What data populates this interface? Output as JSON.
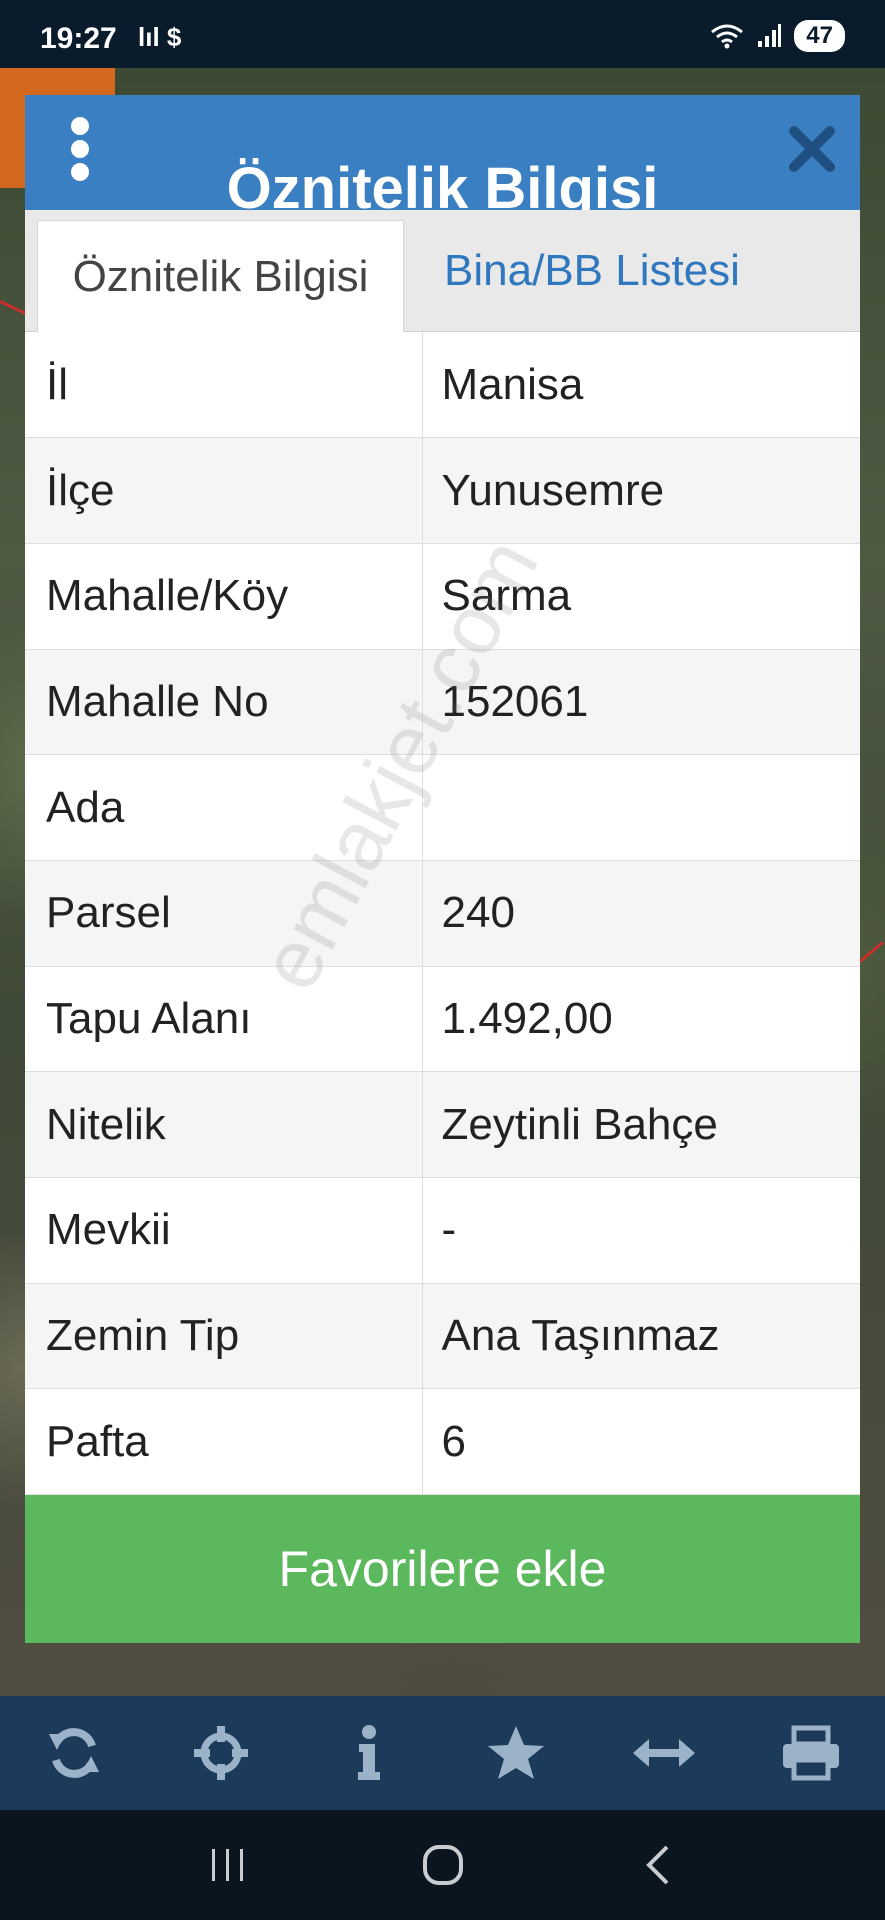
{
  "status_bar": {
    "time": "19:27",
    "left_icons": "lıl $",
    "battery": "47"
  },
  "dialog": {
    "title": "Öznitelik Bilgisi",
    "tabs": [
      {
        "label": "Öznitelik Bilgisi",
        "active": true
      },
      {
        "label": "Bina/BB Listesi",
        "active": false
      }
    ],
    "rows": [
      {
        "key": "İl",
        "value": "Manisa"
      },
      {
        "key": "İlçe",
        "value": "Yunusemre"
      },
      {
        "key": "Mahalle/Köy",
        "value": "Sarma"
      },
      {
        "key": "Mahalle No",
        "value": "152061"
      },
      {
        "key": "Ada",
        "value": ""
      },
      {
        "key": "Parsel",
        "value": "240"
      },
      {
        "key": "Tapu Alanı",
        "value": "1.492,00"
      },
      {
        "key": "Nitelik",
        "value": "Zeytinli Bahçe"
      },
      {
        "key": "Mevkii",
        "value": "-"
      },
      {
        "key": "Zemin Tip",
        "value": "Ana Taşınmaz"
      },
      {
        "key": "Pafta",
        "value": "6"
      }
    ],
    "favorite_button": "Favorilere ekle"
  },
  "watermark": "emlakjet.com",
  "toolbar": {
    "icons": [
      "refresh-icon",
      "crosshair-icon",
      "info-icon",
      "star-icon",
      "measure-icon",
      "print-icon"
    ]
  },
  "navbar": {
    "icons": [
      "recent-apps-icon",
      "home-icon",
      "back-icon"
    ]
  },
  "colors": {
    "header_blue": "#3a7fc1",
    "tab_link_blue": "#2f78bf",
    "favorite_green": "#5cb85c",
    "toolbar_navy": "#1c3a5a"
  }
}
